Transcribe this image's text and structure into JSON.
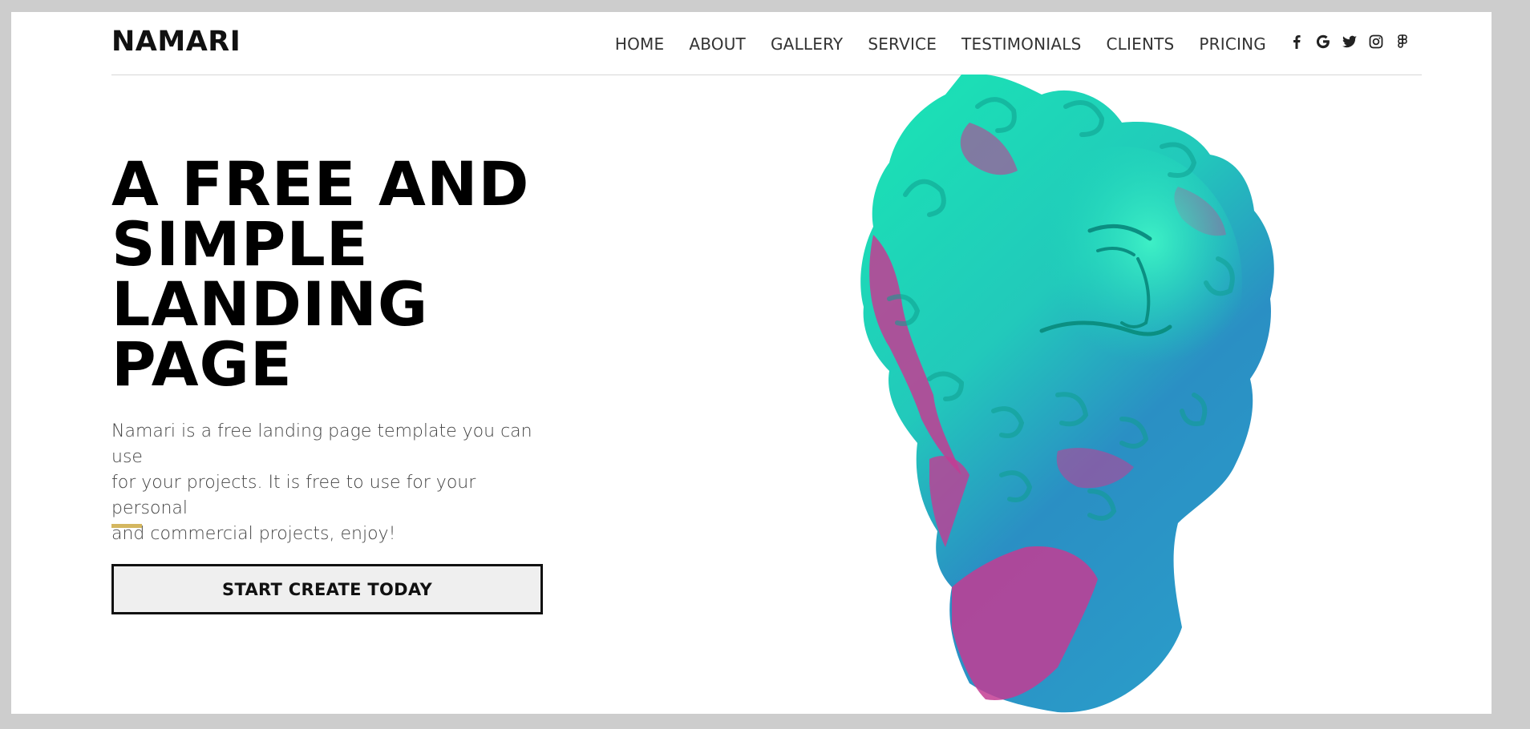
{
  "header": {
    "logo": "NAMARI",
    "nav": [
      "HOME",
      "ABOUT",
      "GALLERY",
      "SERVICE",
      "TESTIMONIALS",
      "CLIENTS",
      "PRICING"
    ],
    "social_icons": [
      "facebook-icon",
      "google-icon",
      "twitter-icon",
      "instagram-icon",
      "figma-icon"
    ]
  },
  "hero": {
    "title_lines": [
      "A FREE AND",
      "SIMPLE",
      "LANDING",
      "PAGE"
    ],
    "description": "Namari is a free landing page template you can use for your personal and commercial projects, enjoy!",
    "description_lines": [
      "Namari is a free landing page template you can use",
      "for your projects. It is free to use for your personal",
      "and commercial projects, enjoy!"
    ],
    "cta_label": "START CREATE TODAY",
    "accent_color": "#d4b760",
    "image": "statue-head-illustration"
  },
  "colors": {
    "teal": "#19e6b4",
    "magenta": "#c33c93",
    "blue": "#2a8fc4"
  }
}
